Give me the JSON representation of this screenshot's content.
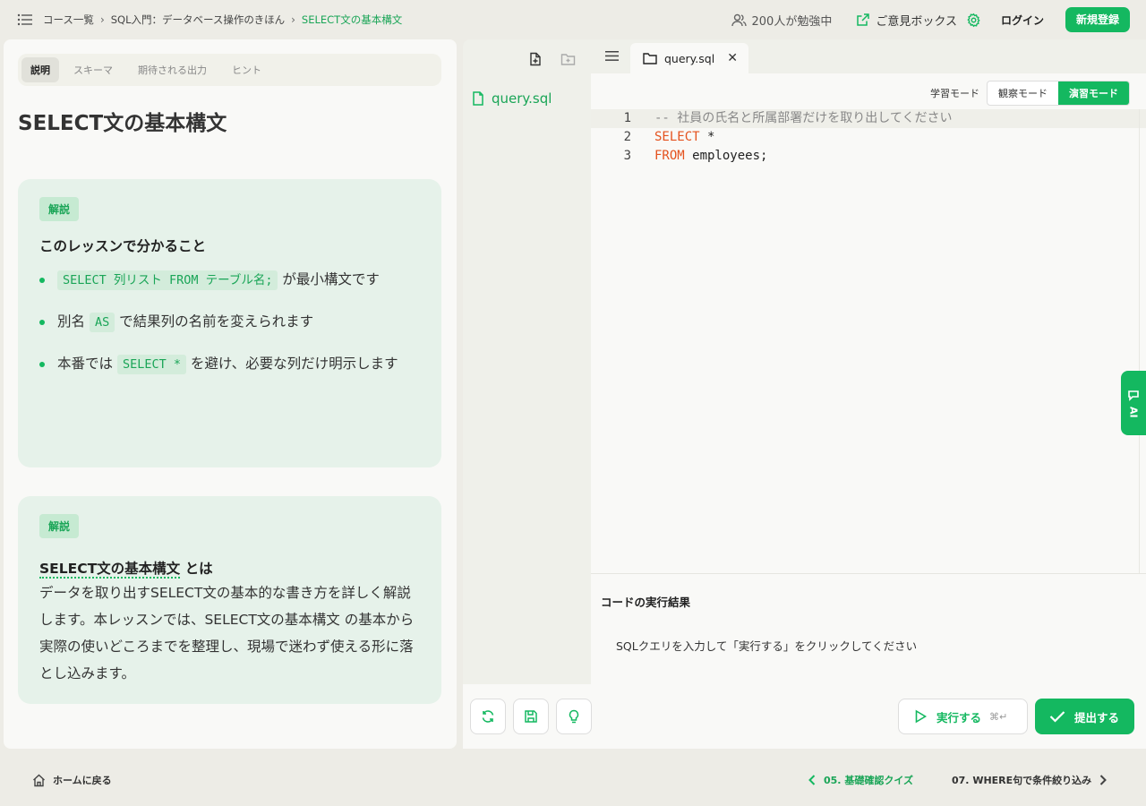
{
  "header": {
    "menu_icon": "list-menu-icon",
    "breadcrumbs": [
      "コース一覧",
      "SQL入門：データベース操作のきほん",
      "SELECT文の基本構文"
    ],
    "learners_text": "200人が勉強中",
    "feedback_label": "ご意見ボックス",
    "login_label": "ログイン",
    "signup_label": "新規登録"
  },
  "lesson": {
    "tabs": [
      "説明",
      "スキーマ",
      "期待される出力",
      "ヒント"
    ],
    "active_tab": "説明",
    "title": "SELECT文の基本構文",
    "card1": {
      "badge": "解説",
      "heading": "このレッスンで分かること",
      "bullets": [
        {
          "code": "SELECT 列リスト FROM テーブル名;",
          "text": "が最小構文です"
        },
        {
          "pre": "別名",
          "code": "AS",
          "text": "で結果列の名前を変えられます"
        },
        {
          "pre": "本番では",
          "code": "SELECT *",
          "text": "を避け、必要な列だけ明示します"
        }
      ]
    },
    "card2": {
      "badge": "解説",
      "heading_term": "SELECT文の基本構文",
      "heading_suffix": "とは",
      "paragraph": "データを取り出すSELECT文の基本的な書き方を詳しく解説します。本レッスンでは、SELECT文の基本構文 の基本から実際の使いどころまでを整理し、現場で迷わず使える形に落とし込みます。"
    }
  },
  "explorer": {
    "files": [
      "query.sql"
    ]
  },
  "editor": {
    "tab_label": "query.sql",
    "mode_label": "学習モード",
    "modes": [
      "観察モード",
      "演習モード"
    ],
    "active_mode": "演習モード",
    "lines": [
      {
        "n": "1",
        "comment": "-- 社員の氏名と所属部署だけを取り出してください"
      },
      {
        "n": "2",
        "kw": "SELECT",
        "rest": " *"
      },
      {
        "n": "3",
        "kw": "FROM",
        "rest": " employees;"
      }
    ]
  },
  "result": {
    "title": "コードの実行結果",
    "message": "SQLクエリを入力して「実行する」をクリックしてください"
  },
  "actions": {
    "run_label": "実行する",
    "run_shortcut": "⌘↵",
    "submit_label": "提出する"
  },
  "ai_tab": {
    "label": "AI"
  },
  "footer": {
    "home_label": "ホームに戻る",
    "prev_label": "05. 基礎確認クイズ",
    "next_label": "07. WHERE句で条件絞り込み"
  },
  "colors": {
    "accent": "#14b860",
    "keyword": "#e4521e"
  }
}
